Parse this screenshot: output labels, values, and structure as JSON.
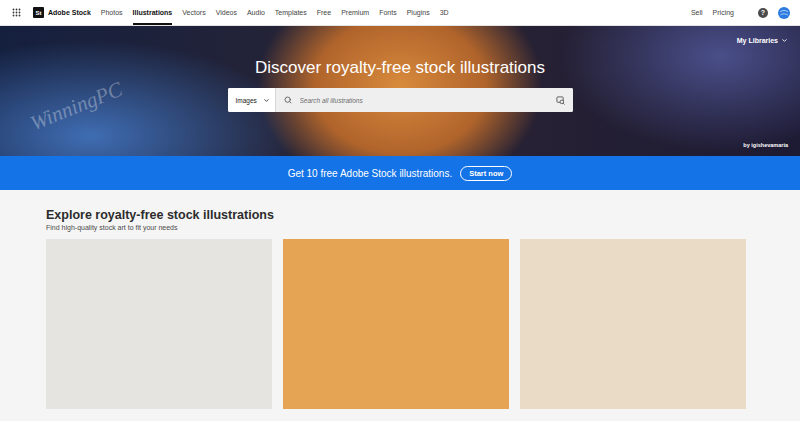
{
  "nav": {
    "logo_mark": "St",
    "brand": "Adobe Stock",
    "items": [
      {
        "label": "Photos",
        "selected": false
      },
      {
        "label": "Illustrations",
        "selected": true
      },
      {
        "label": "Vectors",
        "selected": false
      },
      {
        "label": "Videos",
        "selected": false
      },
      {
        "label": "Audio",
        "selected": false
      },
      {
        "label": "Templates",
        "selected": false
      },
      {
        "label": "Free",
        "selected": false
      },
      {
        "label": "Premium",
        "selected": false
      },
      {
        "label": "Fonts",
        "selected": false
      },
      {
        "label": "Plugins",
        "selected": false
      },
      {
        "label": "3D",
        "selected": false
      }
    ],
    "right": [
      "Sell",
      "Pricing"
    ],
    "help": "?"
  },
  "watermark": "WinningPC",
  "hero": {
    "libraries": "My Libraries",
    "title": "Discover royalty-free stock illustrations",
    "search": {
      "type": "Images",
      "placeholder": "Search all illustrations"
    },
    "credit": "by igishevamaria"
  },
  "banner": {
    "text": "Get 10 free Adobe Stock illustrations.",
    "button": "Start now"
  },
  "explore": {
    "title": "Explore royalty-free stock illustrations",
    "subtitle": "Find high-quality stock art to fit your needs",
    "cards": [
      {
        "color": "#e6e4e1"
      },
      {
        "color": "#e4a453"
      },
      {
        "color": "#eadbc6"
      }
    ]
  }
}
